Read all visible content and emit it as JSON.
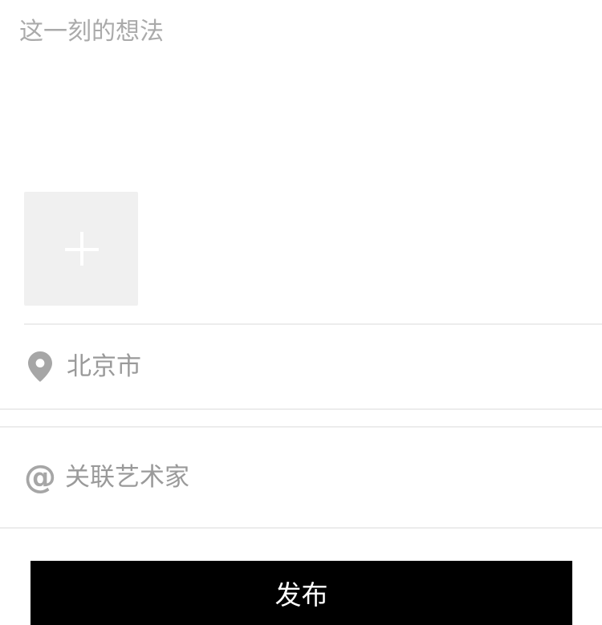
{
  "composer": {
    "placeholder": "这一刻的想法",
    "value": ""
  },
  "media": {
    "add_icon": "plus-icon"
  },
  "location": {
    "icon": "location-pin-icon",
    "label": "北京市"
  },
  "artist": {
    "icon": "at-icon",
    "symbol": "@",
    "label": "关联艺术家"
  },
  "publish": {
    "label": "发布"
  },
  "colors": {
    "background": "#ffffff",
    "placeholder": "#aaaaaa",
    "muted_text": "#9a9a9a",
    "icon_gray": "#a6a6a6",
    "divider": "#ececec",
    "tile": "#f0f0f0",
    "button_bg": "#000000",
    "button_text": "#ffffff"
  }
}
